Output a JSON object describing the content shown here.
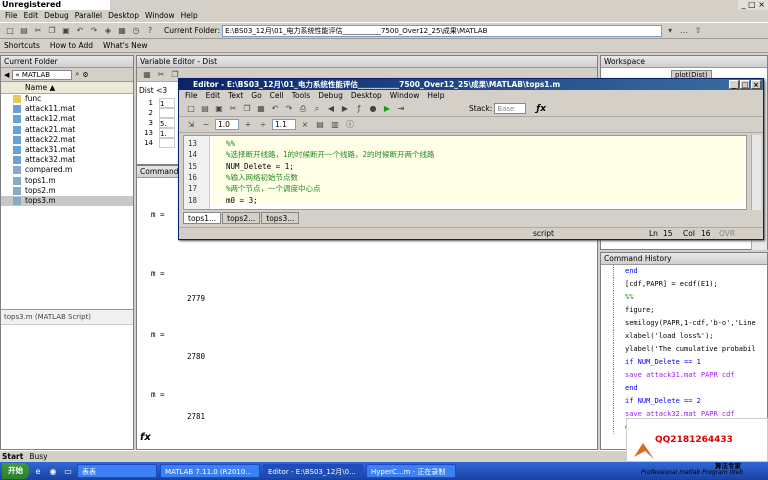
{
  "watermark": "Unregistered HyperCam 2",
  "window_controls": "_ □ ×",
  "menubar": [
    "File",
    "Edit",
    "Debug",
    "Parallel",
    "Desktop",
    "Window",
    "Help"
  ],
  "current_folder": {
    "label": "Current Folder:",
    "path": "E:\\BS03_12月\\01_电力系统性能评估___________7500_Over12_25\\成果\\MATLAB"
  },
  "shortcuts": [
    "Shortcuts",
    "How to Add",
    "What's New"
  ],
  "folder_panel": {
    "title": "Current Folder",
    "nav_path": "« MATLAB",
    "header": "Name ▲",
    "items": [
      {
        "name": "func",
        "type": "folder"
      },
      {
        "name": "attack11.mat",
        "type": "mat"
      },
      {
        "name": "attack12.mat",
        "type": "mat"
      },
      {
        "name": "attack21.mat",
        "type": "mat"
      },
      {
        "name": "attack22.mat",
        "type": "mat"
      },
      {
        "name": "attack31.mat",
        "type": "mat"
      },
      {
        "name": "attack32.mat",
        "type": "mat"
      },
      {
        "name": "compared.m",
        "type": "m"
      },
      {
        "name": "tops1.m",
        "type": "m"
      },
      {
        "name": "tops2.m",
        "type": "m"
      },
      {
        "name": "tops3.m",
        "type": "m"
      }
    ],
    "selected": "tops3.m",
    "details": "tops3.m (MATLAB Script)"
  },
  "variable_editor": {
    "title": "Variable Editor - Dist",
    "var": "Dist <3",
    "rows": [
      "1",
      "2",
      "3",
      "13",
      "14"
    ],
    "row_vals": [
      "1",
      "",
      "5.",
      "1.",
      ""
    ]
  },
  "command_window": {
    "title": "Command Window",
    "lines": [
      {
        "t": "m ="
      },
      {
        "t": "m ="
      },
      {
        "t": "2779"
      },
      {
        "t": "m ="
      },
      {
        "t": "2780"
      },
      {
        "t": "m ="
      },
      {
        "t": "2781"
      }
    ],
    "prompt": "fx"
  },
  "workspace": {
    "title": "Workspace",
    "plot_btn": "plot(Dist)"
  },
  "command_history": {
    "title": "Command History",
    "lines": [
      {
        "t": "end",
        "k": "kw"
      },
      {
        "t": "[cdf,PAPR] = ecdf(E1);",
        "k": ""
      },
      {
        "t": "%%",
        "k": "cm"
      },
      {
        "t": "figure;",
        "k": ""
      },
      {
        "t": "semilogy(PAPR,1-cdf,'b-o','Line",
        "k": ""
      },
      {
        "t": "xlabel('load loss%');",
        "k": ""
      },
      {
        "t": "ylabel('The cumulative probabil",
        "k": ""
      },
      {
        "t": "if NUM_Delete == 1",
        "k": "kw"
      },
      {
        "t": "save attack31.mat PAPR cdf",
        "k": "kw"
      },
      {
        "t": "end",
        "k": "kw"
      },
      {
        "t": "if NUM_Delete == 2",
        "k": "kw"
      },
      {
        "t": "save attack32.mat PAPR cdf",
        "k": "kw"
      },
      {
        "t": "end",
        "k": "kw"
      }
    ]
  },
  "editor": {
    "title": "Editor - E:\\BS03_12月\\01_电力系统性能评估___________7500_Over12_25\\成果\\MATLAB\\tops1.m",
    "menu": [
      "File",
      "Edit",
      "Text",
      "Go",
      "Cell",
      "Tools",
      "Debug",
      "Desktop",
      "Window",
      "Help"
    ],
    "stack_label": "Stack:",
    "stack_value": "Base",
    "zoom1": "1.0",
    "zoom2": "1.1",
    "code": [
      {
        "ln": "13",
        "tx": "%%",
        "c": "cm"
      },
      {
        "ln": "14",
        "tx": "%选择断开线路，1的时候断开一个线路，2的时候断开两个线路",
        "c": "cm"
      },
      {
        "ln": "15",
        "tx": "NUM_Delete  = 1;",
        "c": ""
      },
      {
        "ln": "16",
        "tx": "%输入网络初始节点数",
        "c": "cm"
      },
      {
        "ln": "17",
        "tx": "%两个节点，一个调度中心点",
        "c": "cm"
      },
      {
        "ln": "18",
        "tx": "m0          = 3;",
        "c": ""
      }
    ],
    "tabs": [
      "tops1...",
      "tops2...",
      "tops3..."
    ],
    "status": {
      "type": "script",
      "ln_label": "Ln",
      "ln": "15",
      "col_label": "Col",
      "col": "16",
      "ovr": "OVR"
    }
  },
  "start_status": {
    "start": "Start",
    "state": "Busy"
  },
  "taskbar": {
    "start": "开始",
    "buttons": [
      "表表",
      "MATLAB 7.11.0 (R2010...",
      "Editor - E:\\BS03_12月\\0...",
      "HyperC...m - 正在录制"
    ]
  },
  "ad": {
    "qq": "QQ2181264433",
    "t1": "算法专家",
    "t2": "Professional matlab Program Web"
  }
}
